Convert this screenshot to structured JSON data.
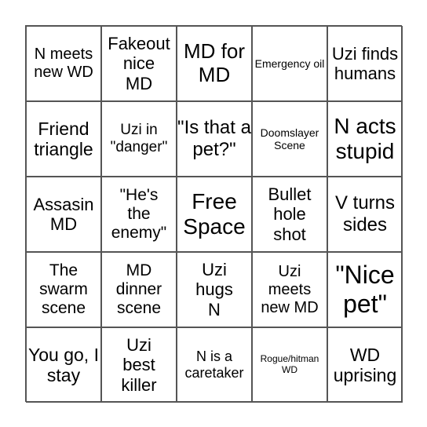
{
  "cells": [
    "N meets new WD",
    "Fakeout nice MD",
    "MD for MD",
    "Emergency oil",
    "Uzi finds humans",
    "Friend triangle",
    "Uzi in \"danger\"",
    "\"Is that a pet?\"",
    "Doomslayer Scene",
    "N acts stupid",
    "Assasin MD",
    "\"He's the enemy\"",
    "Free Space",
    "Bullet hole shot",
    "V turns sides",
    "The swarm scene",
    "MD dinner scene",
    "Uzi hugs N",
    "Uzi meets new MD",
    "\"Nice pet\"",
    "You go, I stay",
    "Uzi best killer",
    "N is a caretaker",
    "Rogue/hitman WD",
    "WD uprising"
  ]
}
